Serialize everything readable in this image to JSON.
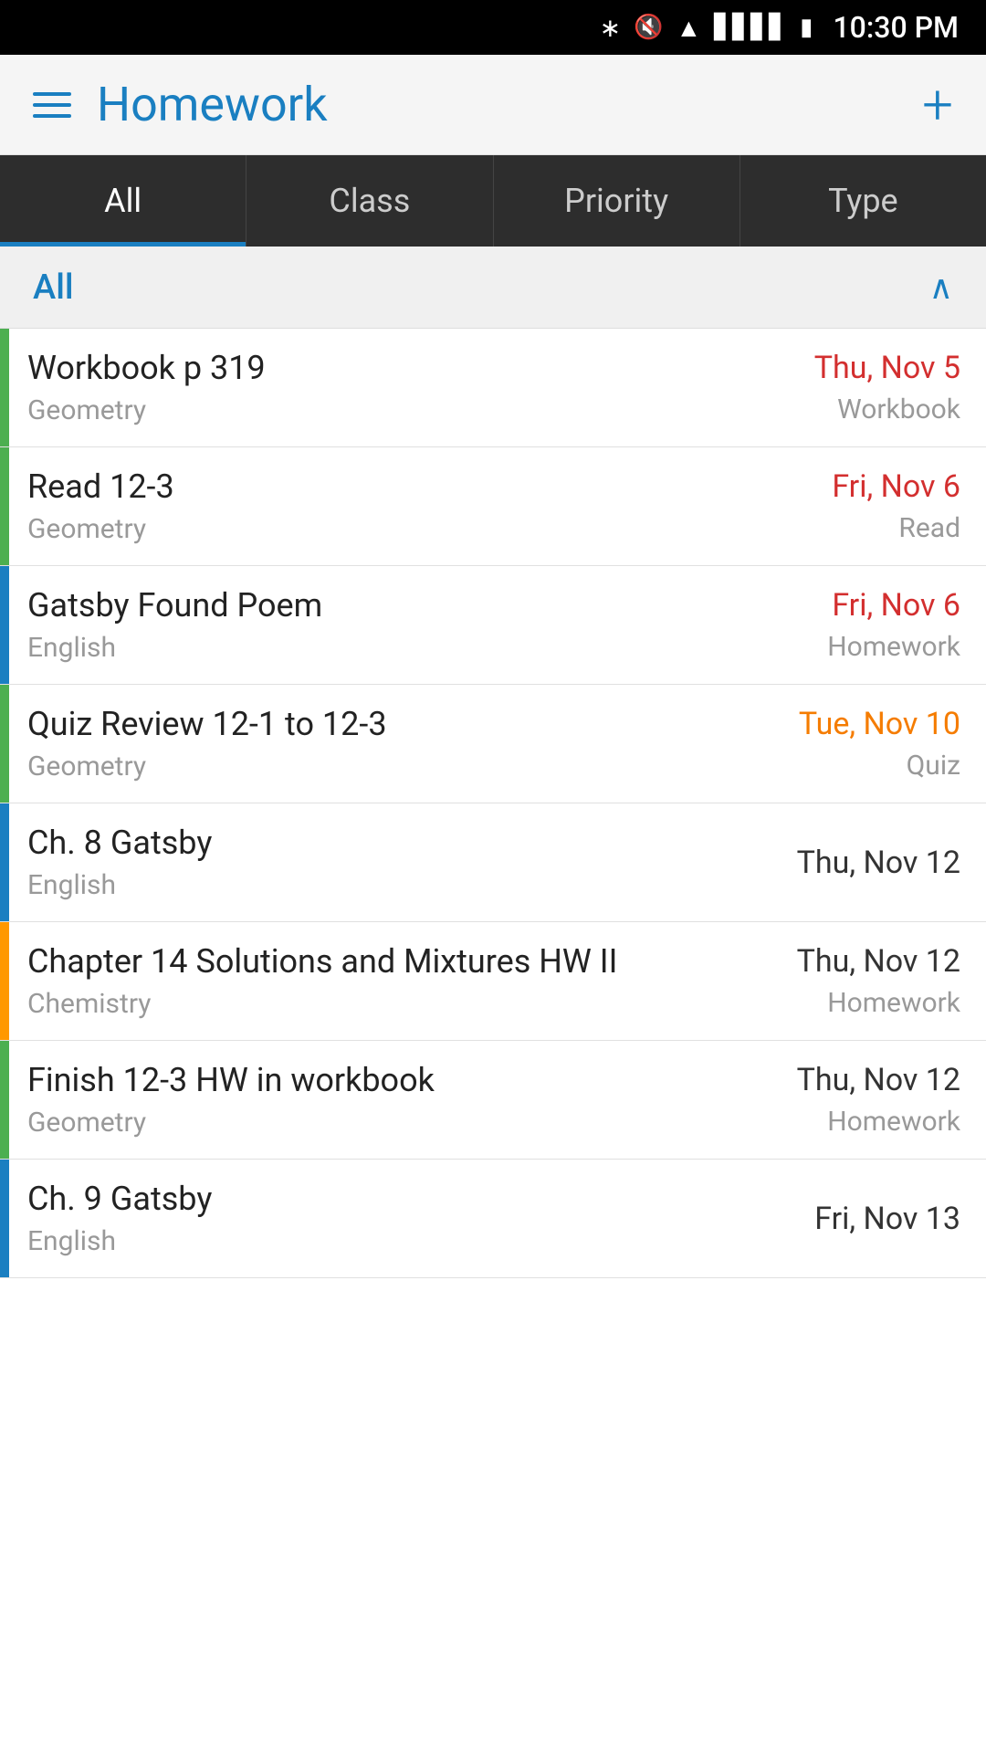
{
  "statusBar": {
    "time": "10:30 PM"
  },
  "header": {
    "title": "Homework",
    "addLabel": "+",
    "menuLabel": "Menu"
  },
  "tabs": [
    {
      "id": "all",
      "label": "All",
      "active": true
    },
    {
      "id": "class",
      "label": "Class",
      "active": false
    },
    {
      "id": "priority",
      "label": "Priority",
      "active": false
    },
    {
      "id": "type",
      "label": "Type",
      "active": false
    }
  ],
  "filter": {
    "label": "All",
    "chevron": "∧"
  },
  "items": [
    {
      "title": "Workbook p 319",
      "subtitle": "Geometry",
      "date": "Thu, Nov 5",
      "dateColor": "red",
      "type": "Workbook",
      "accent": "green"
    },
    {
      "title": "Read 12-3",
      "subtitle": "Geometry",
      "date": "Fri, Nov 6",
      "dateColor": "red",
      "type": "Read",
      "accent": "green"
    },
    {
      "title": "Gatsby Found Poem",
      "subtitle": "English",
      "date": "Fri, Nov 6",
      "dateColor": "red",
      "type": "Homework",
      "accent": "blue"
    },
    {
      "title": "Quiz Review 12-1 to 12-3",
      "subtitle": "Geometry",
      "date": "Tue, Nov 10",
      "dateColor": "orange",
      "type": "Quiz",
      "accent": "green"
    },
    {
      "title": "Ch. 8 Gatsby",
      "subtitle": "English",
      "date": "Thu, Nov 12",
      "dateColor": "black",
      "type": "",
      "accent": "blue"
    },
    {
      "title": "Chapter 14 Solutions and Mixtures HW II",
      "subtitle": "Chemistry",
      "date": "Thu, Nov 12",
      "dateColor": "black",
      "type": "Homework",
      "accent": "orange"
    },
    {
      "title": "Finish 12-3 HW in workbook",
      "subtitle": "Geometry",
      "date": "Thu, Nov 12",
      "dateColor": "black",
      "type": "Homework",
      "accent": "green"
    },
    {
      "title": "Ch. 9 Gatsby",
      "subtitle": "English",
      "date": "Fri, Nov 13",
      "dateColor": "black",
      "type": "",
      "accent": "blue"
    }
  ]
}
